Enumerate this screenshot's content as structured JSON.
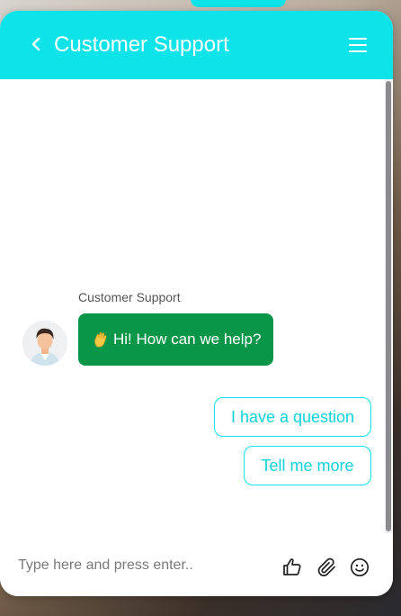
{
  "header": {
    "title": "Customer Support",
    "back_icon": "chevron-left-icon",
    "menu_icon": "hamburger-menu-icon"
  },
  "conversation": {
    "sender_name": "Customer Support",
    "avatar_icon": "agent-avatar-icon",
    "bot_message_emoji_icon": "waving-hand-icon",
    "bot_message": "Hi! How can we help?",
    "quick_replies": [
      {
        "label": "I have a question"
      },
      {
        "label": "Tell me more"
      }
    ]
  },
  "input_bar": {
    "placeholder": "Type here and press enter..",
    "value": "",
    "actions": [
      "thumbs-up-icon",
      "paperclip-icon",
      "emoji-icon"
    ]
  },
  "colors": {
    "accent": "#0de4ea",
    "bot_bubble": "#0a9648",
    "quick_reply_text": "#0dd3da"
  }
}
